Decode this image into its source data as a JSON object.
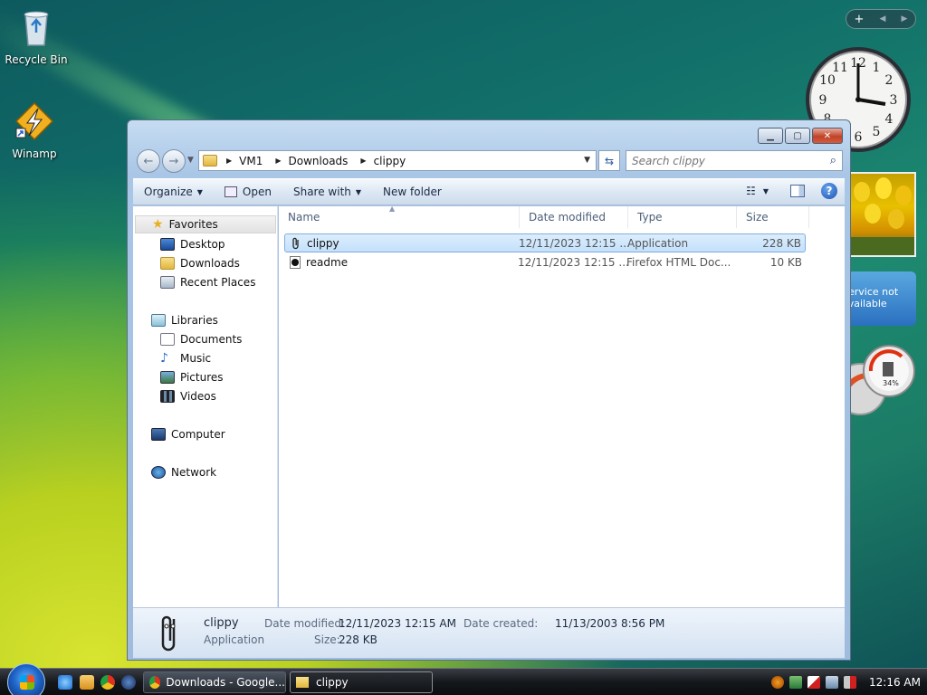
{
  "desktop": {
    "icons": [
      {
        "label": "Recycle Bin"
      },
      {
        "label": "Winamp"
      }
    ]
  },
  "gadgets": {
    "weather_text": "Service not available",
    "meter_value": "34%"
  },
  "window": {
    "address": {
      "crumbs": [
        "VM1",
        "Downloads",
        "clippy"
      ]
    },
    "search": {
      "placeholder": "Search clippy"
    },
    "toolbar": {
      "organize": "Organize",
      "open": "Open",
      "share_with": "Share with",
      "new_folder": "New folder"
    },
    "nav_pane": {
      "favorites": "Favorites",
      "desktop": "Desktop",
      "downloads": "Downloads",
      "recent_places": "Recent Places",
      "libraries": "Libraries",
      "documents": "Documents",
      "music": "Music",
      "pictures": "Pictures",
      "videos": "Videos",
      "computer": "Computer",
      "network": "Network"
    },
    "columns": {
      "name": "Name",
      "date_modified": "Date modified",
      "type": "Type",
      "size": "Size"
    },
    "files": [
      {
        "name": "clippy",
        "date": "12/11/2023 12:15 ...",
        "type": "Application",
        "size": "228 KB"
      },
      {
        "name": "readme",
        "date": "12/11/2023 12:15 ...",
        "type": "Firefox HTML Doc...",
        "size": "10 KB"
      }
    ],
    "details": {
      "name": "clippy",
      "kind": "Application",
      "date_modified_label": "Date modified:",
      "date_modified": "12/11/2023 12:15 AM",
      "date_created_label": "Date created:",
      "date_created": "11/13/2003 8:56 PM",
      "size_label": "Size:",
      "size": "228 KB"
    }
  },
  "taskbar": {
    "tasks": [
      "Downloads - Google...",
      "clippy"
    ],
    "time": "12:16 AM"
  }
}
